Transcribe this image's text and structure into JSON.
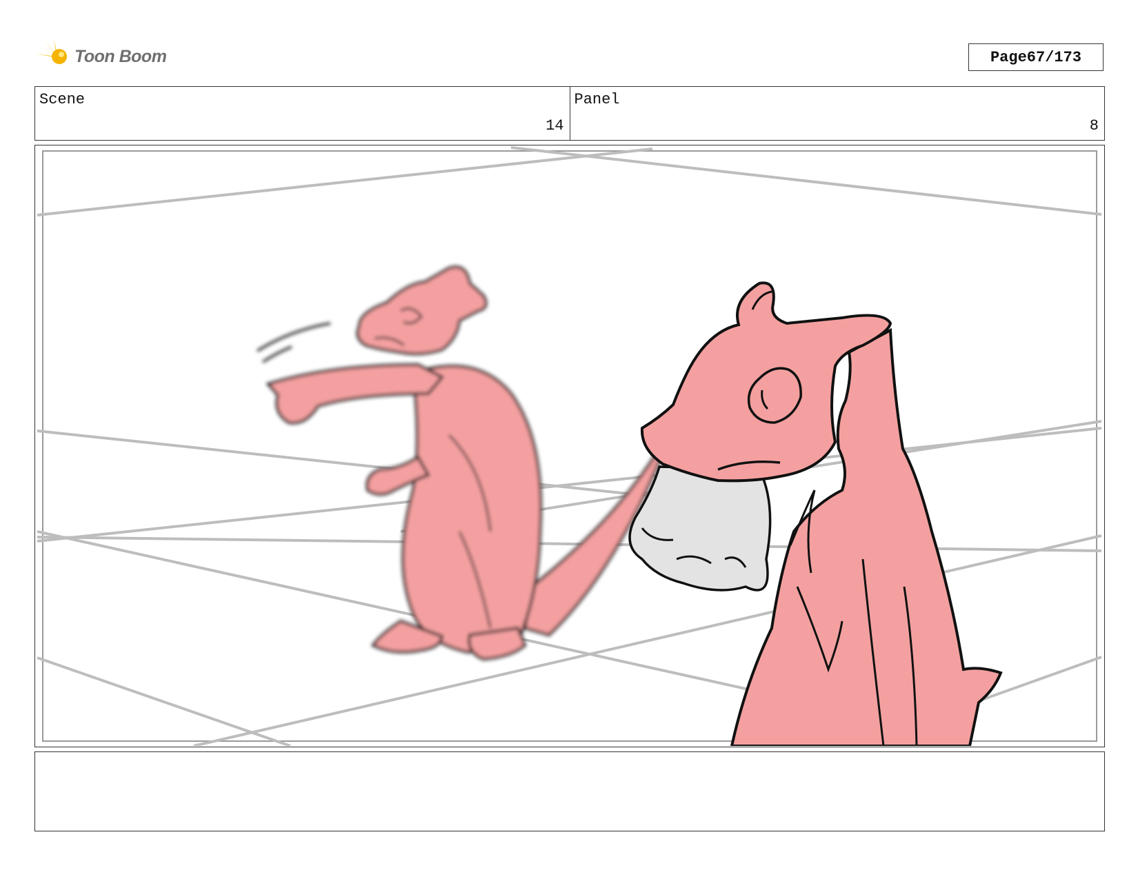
{
  "header": {
    "brand": "Toon Boom",
    "page_label": "Page",
    "page_value": "67/173"
  },
  "info": {
    "scene_label": "Scene",
    "scene_value": "14",
    "panel_label": "Panel",
    "panel_value": "8"
  },
  "panel": {
    "notes_text": ""
  },
  "colors": {
    "character_fill": "#f4a0a0",
    "snout_fill": "#e3e3e3",
    "guide_line": "#bdbdbd",
    "logo_yellow": "#f5c518"
  }
}
